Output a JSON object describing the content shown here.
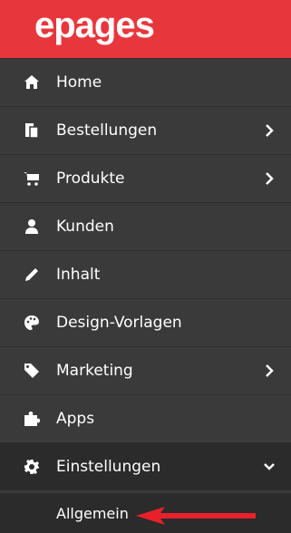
{
  "logo": {
    "text": "epages"
  },
  "nav": {
    "items": [
      {
        "label": "Home",
        "icon": "home-icon"
      },
      {
        "label": "Bestellungen",
        "icon": "orders-icon",
        "chevron": "chevron-right-icon"
      },
      {
        "label": "Produkte",
        "icon": "cart-icon",
        "chevron": "chevron-right-icon"
      },
      {
        "label": "Kunden",
        "icon": "user-icon"
      },
      {
        "label": "Inhalt",
        "icon": "pencil-icon"
      },
      {
        "label": "Design-Vorlagen",
        "icon": "palette-icon"
      },
      {
        "label": "Marketing",
        "icon": "tag-icon",
        "chevron": "chevron-right-icon"
      },
      {
        "label": "Apps",
        "icon": "puzzle-icon"
      },
      {
        "label": "Einstellungen",
        "icon": "gear-icon",
        "chevron": "chevron-down-icon"
      }
    ],
    "subitem": {
      "label": "Allgemein"
    }
  },
  "colors": {
    "header": "#e8373c",
    "sidebar": "#3a3a3a",
    "active": "#2b2b2b",
    "annotation_arrow": "#e8202a"
  }
}
